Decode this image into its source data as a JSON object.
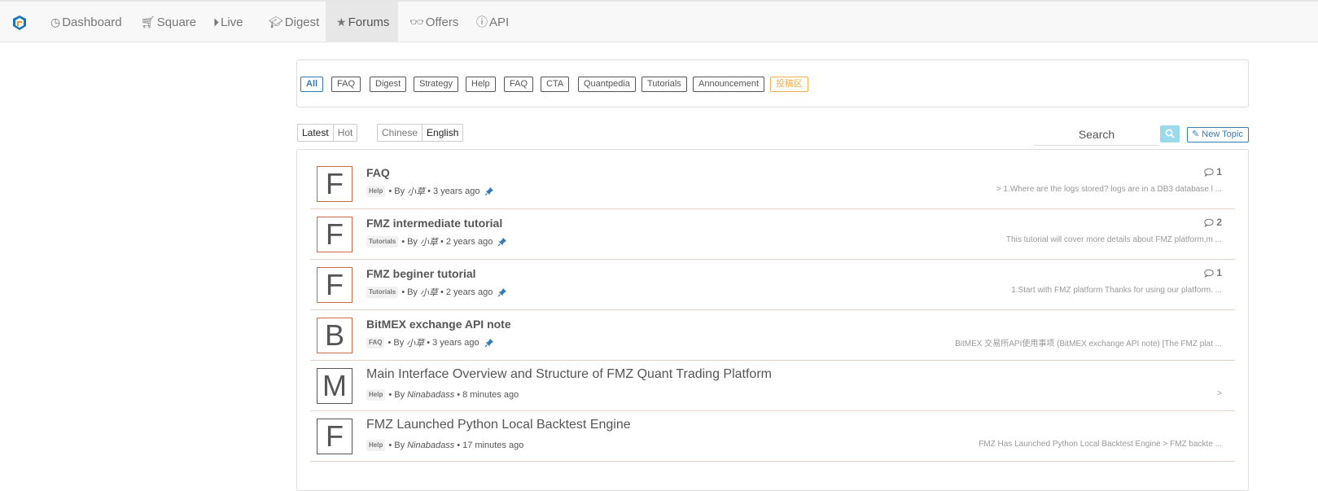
{
  "nav": {
    "items": [
      {
        "label": "Dashboard",
        "icon": "dashboard-icon",
        "active": false
      },
      {
        "label": "Square",
        "icon": "cart-icon",
        "active": false
      },
      {
        "label": "Live",
        "icon": "play-circle-icon",
        "active": false
      },
      {
        "label": "Digest",
        "icon": "graduation-cap-icon",
        "active": false
      },
      {
        "label": "Forums",
        "icon": "star-icon",
        "active": true
      },
      {
        "label": "Offers",
        "icon": "glasses-icon",
        "active": false
      },
      {
        "label": "API",
        "icon": "info-circle-icon",
        "active": false
      }
    ]
  },
  "categories": [
    "All",
    "FAQ",
    "Digest",
    "Strategy",
    "Help",
    "FAQ",
    "CTA",
    "Quantpedia",
    "Tutorials",
    "Announcement",
    "投稿区"
  ],
  "sort": {
    "options": [
      "Latest",
      "Hot"
    ],
    "selected": "Latest"
  },
  "language": {
    "options": [
      "Chinese",
      "English"
    ],
    "selected": "English"
  },
  "search": {
    "placeholder": "Search"
  },
  "new_topic": {
    "label": "New Topic"
  },
  "topics": [
    {
      "initial": "F",
      "title": "FAQ",
      "tag": "Help",
      "by": "• By",
      "author": "小草",
      "time": "• 3 years ago",
      "pinned": true,
      "replies": "1",
      "excerpt": "> 1.Where are the logs stored? logs are in a DB3 database l ..."
    },
    {
      "initial": "F",
      "title": "FMZ intermediate tutorial",
      "tag": "Tutorials",
      "by": "• By",
      "author": "小草",
      "time": "• 2 years ago",
      "pinned": true,
      "replies": "2",
      "excerpt": "This tutorial will cover more details about FMZ platform,m ..."
    },
    {
      "initial": "F",
      "title": "FMZ beginer tutorial",
      "tag": "Tutorials",
      "by": "• By",
      "author": "小草",
      "time": "• 2 years ago",
      "pinned": true,
      "replies": "1",
      "excerpt": "1.Start with FMZ platform Thanks for using our platform. ..."
    },
    {
      "initial": "B",
      "title": "BitMEX exchange API note",
      "tag": "FAQ",
      "by": "• By",
      "author": "小草",
      "time": "• 3 years ago",
      "pinned": true,
      "replies": "",
      "excerpt": "BitMEX 交易所API使用事项 (BitMEX exchange API note) [The FMZ plat ..."
    },
    {
      "initial": "M",
      "title": "Main Interface Overview and Structure of FMZ Quant Trading Platform",
      "tag": "Help",
      "by": "• By",
      "author": "Ninabadass",
      "time": "• 8 minutes ago",
      "pinned": false,
      "replies": "",
      "excerpt": ">"
    },
    {
      "initial": "F",
      "title": "FMZ Launched Python Local Backtest Engine",
      "tag": "Help",
      "by": "• By",
      "author": "Ninabadass",
      "time": "• 17 minutes ago",
      "pinned": false,
      "replies": "",
      "excerpt": "FMZ Has Launched Python Local Backtest Engine > FMZ backte ..."
    }
  ]
}
